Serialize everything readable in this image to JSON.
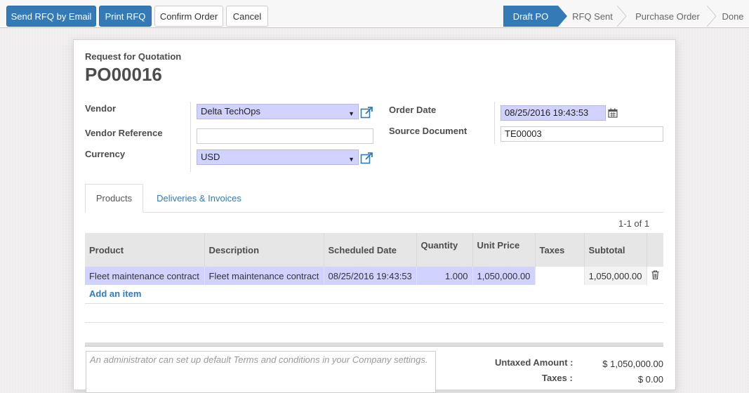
{
  "toolbar": {
    "send_rfq": "Send RFQ by Email",
    "print_rfq": "Print RFQ",
    "confirm_order": "Confirm Order",
    "cancel": "Cancel"
  },
  "stages": [
    "Draft PO",
    "RFQ Sent",
    "Purchase Order",
    "Done"
  ],
  "active_stage": "Draft PO",
  "doc": {
    "kind": "Request for Quotation",
    "name": "PO00016"
  },
  "form": {
    "vendor_label": "Vendor",
    "vendor_value": "Delta TechOps",
    "vendor_ref_label": "Vendor Reference",
    "vendor_ref_value": "",
    "currency_label": "Currency",
    "currency_value": "USD",
    "order_date_label": "Order Date",
    "order_date_value": "08/25/2016 19:43:53",
    "source_doc_label": "Source Document",
    "source_doc_value": "TE00003"
  },
  "tabs": [
    "Products",
    "Deliveries & Invoices"
  ],
  "pager": "1-1 of 1",
  "lines": {
    "columns": [
      "Product",
      "Description",
      "Scheduled Date",
      "Quantity",
      "Unit Price",
      "Taxes",
      "Subtotal"
    ],
    "rows": [
      {
        "product": "Fleet maintenance contract",
        "description": "Fleet maintenance contract",
        "scheduled_date": "08/25/2016 19:43:53",
        "quantity": "1.000",
        "unit_price": "1,050,000.00",
        "taxes": "",
        "subtotal": "1,050,000.00"
      }
    ],
    "add_item": "Add an item"
  },
  "notes_placeholder": "An administrator can set up default Terms and conditions in your Company settings.",
  "totals": {
    "untaxed_label": "Untaxed Amount :",
    "untaxed_value": "$ 1,050,000.00",
    "taxes_label": "Taxes :",
    "taxes_value": "$ 0.00"
  },
  "colors": {
    "primary": "#337ab7",
    "required_field": "#d2d2ff"
  },
  "icons": [
    "external-link-icon",
    "calendar-icon",
    "trash-icon",
    "caret-down-icon"
  ]
}
